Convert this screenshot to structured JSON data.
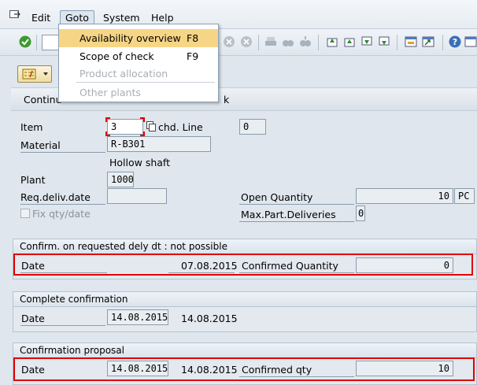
{
  "menubar": {
    "items": [
      "Edit",
      "Goto",
      "System",
      "Help"
    ]
  },
  "goto_menu": {
    "items": [
      {
        "label": "Availability overview",
        "shortcut": "F8"
      },
      {
        "label": "Scope of check",
        "shortcut": "F9"
      },
      {
        "label": "Product allocation",
        "shortcut": ""
      },
      {
        "label": "Other plants",
        "shortcut": ""
      }
    ]
  },
  "appbar": {
    "continue_label": "Continu",
    "right_fragment": "k"
  },
  "header": {
    "item_label": "Item",
    "item_value": "3",
    "sched_line_label": "chd. Line",
    "sched_line_value": "0",
    "material_label": "Material",
    "material_value": "R-B301",
    "material_desc": "Hollow shaft",
    "plant_label": "Plant",
    "plant_value": "1000",
    "req_deliv_label": "Req.deliv.date",
    "req_deliv_value": "",
    "open_qty_label": "Open Quantity",
    "open_qty_value": "10",
    "open_qty_unit": "PC",
    "fix_qty_label": "Fix qty/date",
    "max_part_label": "Max.Part.Deliveries",
    "max_part_value": "0"
  },
  "group1": {
    "title": "Confirm. on requested dely dt : not possible",
    "date_label": "Date",
    "date_value": "07.08.2015",
    "qty_label": "Confirmed Quantity",
    "qty_value": "0"
  },
  "group2": {
    "title": "Complete confirmation",
    "date_label": "Date",
    "date_field": "14.08.2015",
    "date_text": "14.08.2015"
  },
  "group3": {
    "title": "Confirmation proposal",
    "date_label": "Date",
    "date_field": "14.08.2015",
    "date_text": "14.08.2015",
    "qty_label": "Confirmed qty",
    "qty_value": "10"
  },
  "colors": {
    "highlight_border": "#e00000",
    "menu_selected": "#f6d686",
    "background": "#dfe6ed"
  }
}
